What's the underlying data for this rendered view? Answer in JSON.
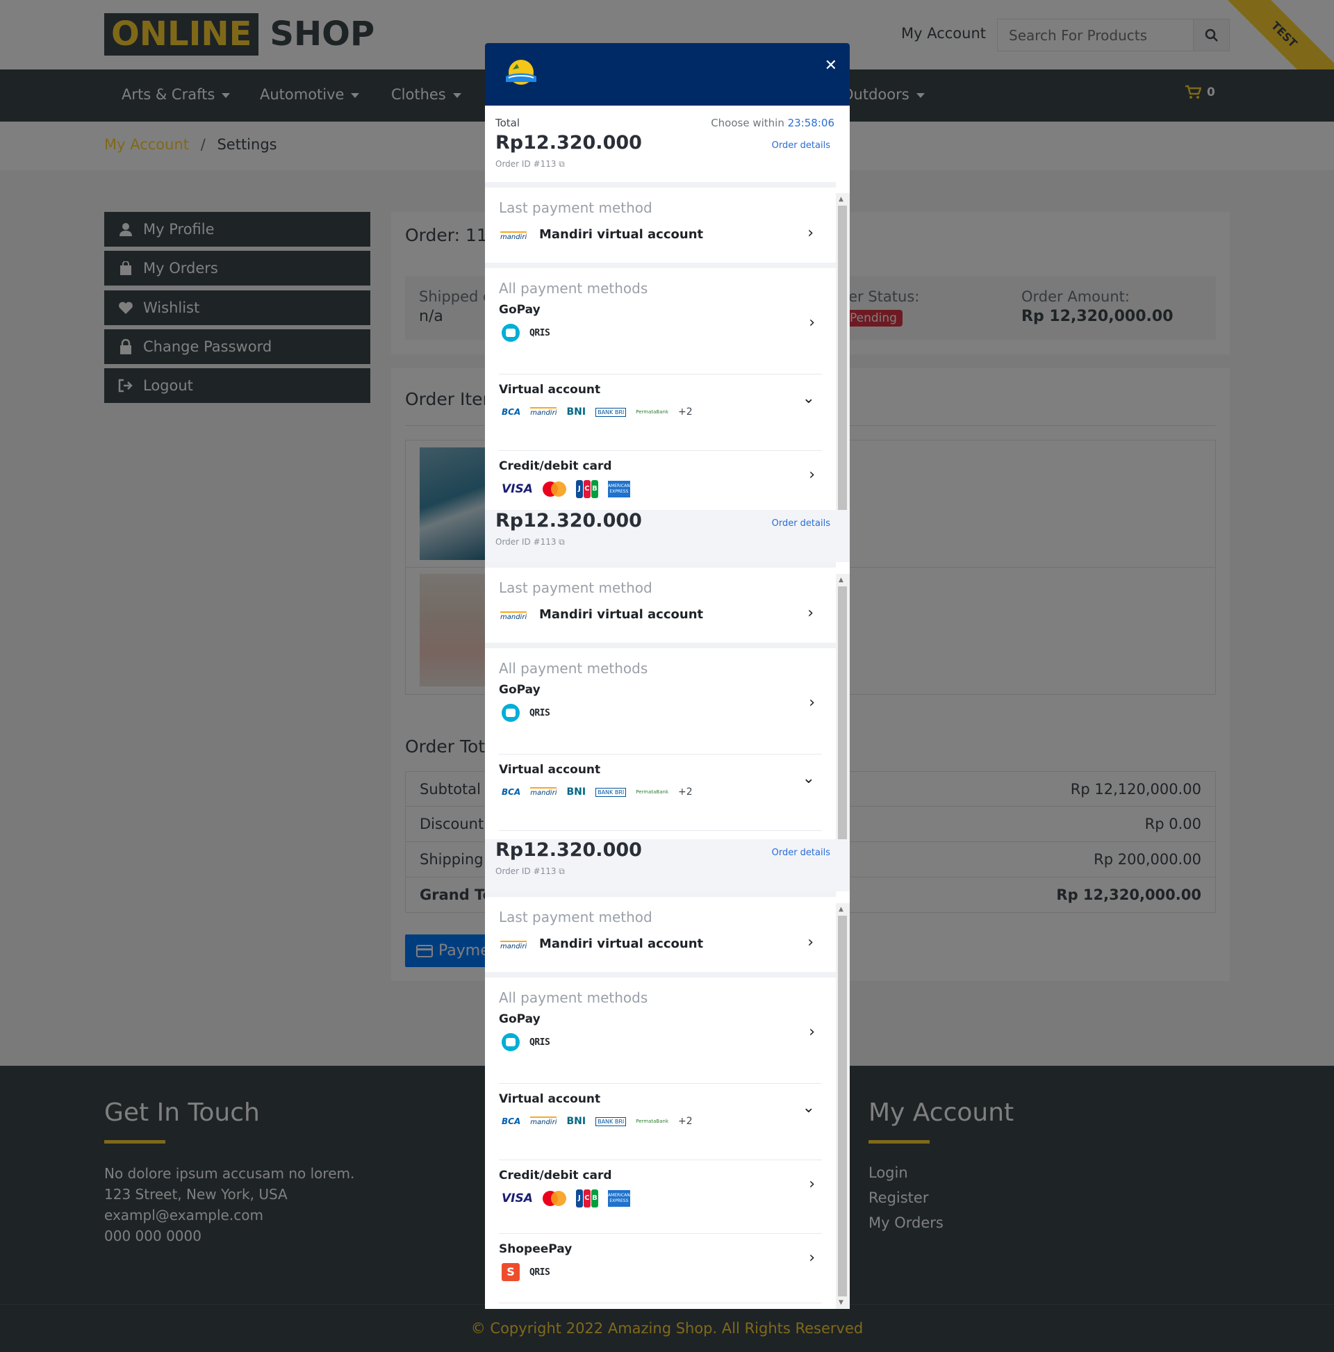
{
  "header": {
    "logo_part1": "ONLINE",
    "logo_part2": "SHOP",
    "my_account": "My Account",
    "search_placeholder": "Search For Products",
    "ribbon": "TEST",
    "cart_count": "0"
  },
  "nav": {
    "items": [
      "Arts & Crafts",
      "Automotive",
      "Clothes",
      "Outdoors"
    ]
  },
  "breadcrumb": {
    "root": "My Account",
    "current": "Settings"
  },
  "sidebar": {
    "items": [
      "My Profile",
      "My Orders",
      "Wishlist",
      "Change Password",
      "Logout"
    ]
  },
  "order": {
    "title": "Order: 113",
    "shipped_label": "Shipped on",
    "shipped_value": "n/a",
    "status_label": "Order Status:",
    "status_value": "Pending",
    "amount_label": "Order Amount:",
    "amount_value": "Rp 12,320,000.00",
    "items_title": "Order Items",
    "totals_title": "Order Totals",
    "totals": [
      {
        "label": "Subtotal",
        "value": "Rp 12,120,000.00"
      },
      {
        "label": "Discount",
        "value": "Rp 0.00"
      },
      {
        "label": "Shipping",
        "value": "Rp 200,000.00"
      },
      {
        "label": "Grand Total",
        "value": "Rp 12,320,000.00"
      }
    ],
    "pay_button": "Payment"
  },
  "footer": {
    "contact_title": "Get In Touch",
    "contact_lines": [
      "No dolore ipsum accusam no lorem.",
      "123 Street, New York, USA",
      "exampl@example.com",
      "000 000 0000"
    ],
    "account_title": "My Account",
    "account_links": [
      "Login",
      "Register",
      "My Orders"
    ],
    "copyright": "© Copyright 2022 Amazing Shop. All Rights Reserved"
  },
  "modal": {
    "total_label": "Total",
    "amount": "Rp12.320.000",
    "order_id": "Order ID #113",
    "choose_within": "Choose within",
    "timer": "23:58:06",
    "order_details": "Order details",
    "last_payment_title": "Last payment method",
    "last_payment_name": "Mandiri virtual account",
    "all_methods_title": "All payment methods",
    "gopay": "GoPay",
    "virtual_account": "Virtual account",
    "va_more": "+2",
    "credit_card": "Credit/debit card",
    "shopeepay": "ShopeePay",
    "qris": "QRIS",
    "bca": "BCA",
    "mandiri": "mandiri",
    "bni": "BNI",
    "bri": "BANK BRI",
    "permata": "PermataBank",
    "visa": "VISA",
    "jcb": "JCB",
    "amex": "AMERICAN EXPRESS"
  }
}
